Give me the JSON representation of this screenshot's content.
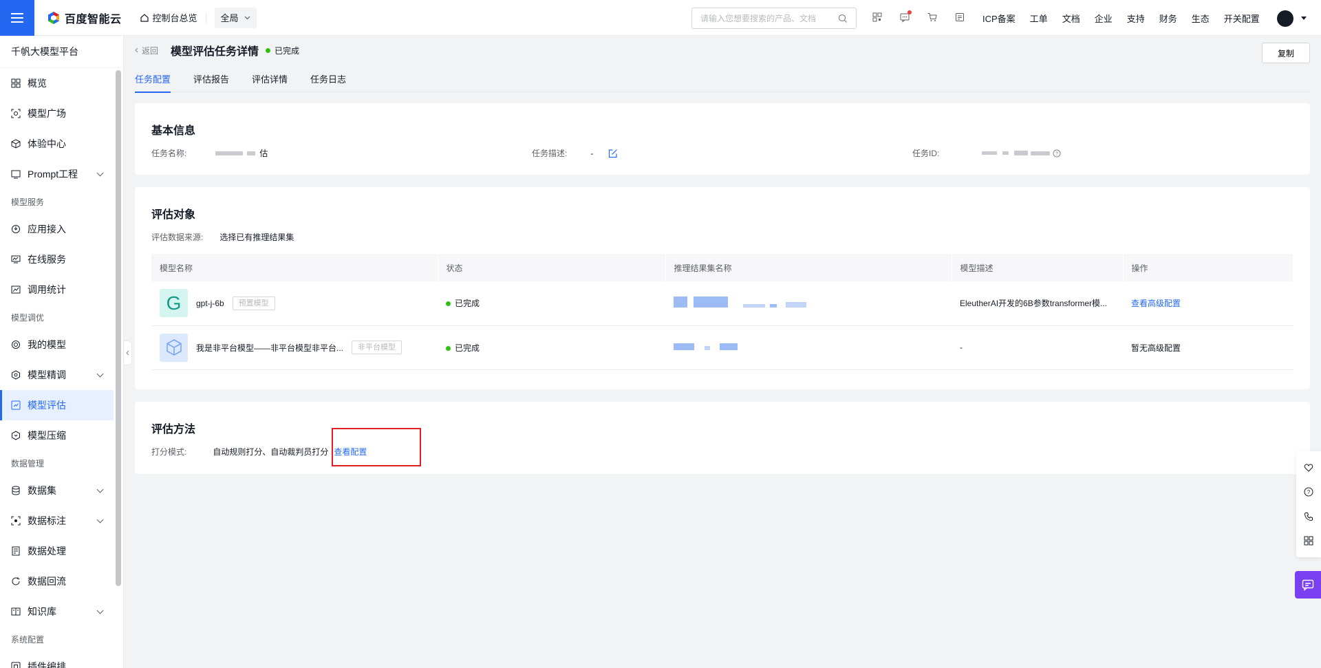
{
  "topbar": {
    "brand": "百度智能云",
    "console_home": "控制台总览",
    "region": "全局",
    "search_placeholder": "请输入您想要搜索的产品、文档",
    "links": [
      "ICP备案",
      "工单",
      "文档",
      "企业",
      "支持",
      "财务",
      "生态",
      "开关配置"
    ],
    "colors": {
      "primary": "#2468f2",
      "notification_dot": "#f33e3e"
    }
  },
  "sidebar": {
    "title": "千帆大模型平台",
    "items": [
      {
        "label": "概览",
        "icon": "grid-icon"
      },
      {
        "label": "模型广场",
        "icon": "scan-icon"
      },
      {
        "label": "体验中心",
        "icon": "cube-icon"
      },
      {
        "label": "Prompt工程",
        "icon": "terminal-icon",
        "expandable": true
      }
    ],
    "group_model_service": "模型服务",
    "service_items": [
      {
        "label": "应用接入",
        "icon": "plug-icon"
      },
      {
        "label": "在线服务",
        "icon": "monitor-icon"
      },
      {
        "label": "调用统计",
        "icon": "chart-icon"
      }
    ],
    "group_model_tuning": "模型调优",
    "tuning_items": [
      {
        "label": "我的模型",
        "icon": "model-icon"
      },
      {
        "label": "模型精调",
        "icon": "tune-icon",
        "expandable": true
      },
      {
        "label": "模型评估",
        "icon": "evaluate-icon",
        "active": true
      },
      {
        "label": "模型压缩",
        "icon": "compress-icon"
      }
    ],
    "group_data": "数据管理",
    "data_items": [
      {
        "label": "数据集",
        "icon": "database-icon",
        "expandable": true
      },
      {
        "label": "数据标注",
        "icon": "annotate-icon",
        "expandable": true
      },
      {
        "label": "数据处理",
        "icon": "process-icon"
      },
      {
        "label": "数据回流",
        "icon": "refresh-icon"
      },
      {
        "label": "知识库",
        "icon": "book-icon",
        "expandable": true
      }
    ],
    "group_system": "系统配置",
    "system_items": [
      {
        "label": "插件编排",
        "icon": "plugin-icon"
      }
    ]
  },
  "page": {
    "back": "返回",
    "title": "模型评估任务详情",
    "status": "已完成",
    "copy_button": "复制",
    "tabs": [
      "任务配置",
      "评估报告",
      "评估详情",
      "任务日志"
    ],
    "active_tab": 0
  },
  "basic_info": {
    "heading": "基本信息",
    "task_name_label": "任务名称:",
    "task_name_suffix": "估",
    "task_desc_label": "任务描述:",
    "task_desc_value": "-",
    "task_id_label": "任务ID:"
  },
  "eval_target": {
    "heading": "评估对象",
    "source_label": "评估数据来源:",
    "source_value": "选择已有推理结果集",
    "columns": [
      "模型名称",
      "状态",
      "推理结果集名称",
      "模型描述",
      "操作"
    ],
    "rows": [
      {
        "logo_letter": "G",
        "model_name": "gpt-j-6b",
        "tag": "预置模型",
        "status": "已完成",
        "description": "EleutherAI开发的6B参数transformer模...",
        "action": "查看高级配置",
        "action_link": true
      },
      {
        "logo_letter": "",
        "model_name": "我是非平台模型——非平台模型非平台...",
        "tag": "非平台模型",
        "status": "已完成",
        "description": "-",
        "action": "暂无高级配置",
        "action_link": false
      }
    ]
  },
  "eval_method": {
    "heading": "评估方法",
    "mode_label": "打分模式:",
    "mode_value": "自动规则打分、自动裁判员打分",
    "view_config": "查看配置"
  }
}
